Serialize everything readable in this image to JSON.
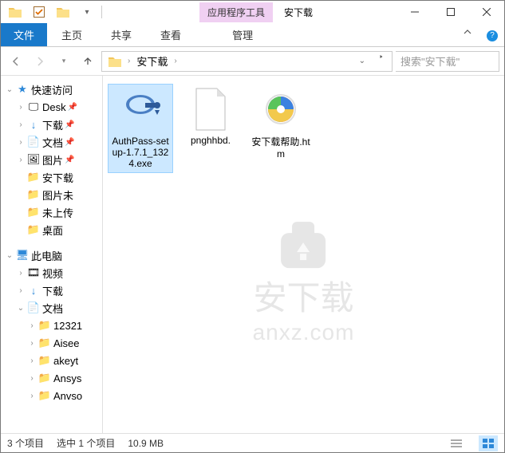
{
  "titlebar": {
    "app_tools": "应用程序工具",
    "title": "安下载"
  },
  "ribbon": {
    "file": "文件",
    "home": "主页",
    "share": "共享",
    "view": "查看",
    "manage": "管理"
  },
  "nav": {
    "breadcrumb": "安下载",
    "search_placeholder": "搜索\"安下载\""
  },
  "sidebar": {
    "quick_access": "快速访问",
    "desktop": "Desk",
    "downloads": "下载",
    "documents": "文档",
    "pictures": "图片",
    "folder_anxz": "安下载",
    "folder_pic2": "图片未",
    "folder_noup": "未上传",
    "folder_desk2": "桌面",
    "this_pc": "此电脑",
    "videos": "视频",
    "downloads2": "下载",
    "documents2": "文档",
    "f1": "12321",
    "f2": "Aisee",
    "f3": "akeyt",
    "f4": "Ansys",
    "f5": "Anvso"
  },
  "files": [
    {
      "name": "AuthPass-setup-1.7.1_1324.exe"
    },
    {
      "name": "pnghhbd."
    },
    {
      "name": "安下载帮助.htm"
    }
  ],
  "watermark": {
    "line1": "安下载",
    "line2": "anxz.com"
  },
  "status": {
    "count": "3 个项目",
    "selected": "选中 1 个项目",
    "size": "10.9 MB"
  }
}
